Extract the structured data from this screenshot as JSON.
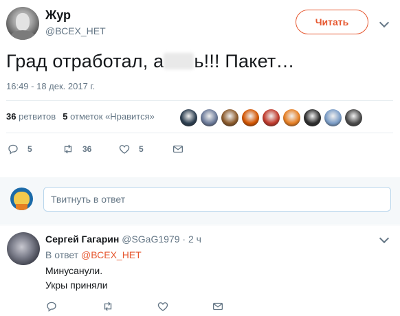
{
  "tweet": {
    "author_name": "Жур",
    "author_handle": "@ВСЕХ_НЕТ",
    "follow_label": "Читать",
    "text_before": "Град отработал, а",
    "text_after": "ь!!! Пакет…",
    "timestamp": "16:49 - 18 дек. 2017 г.",
    "retweets_count": "36",
    "retweets_label": "ретвитов",
    "likes_count": "5",
    "likes_label": "отметок «Нравится»",
    "actions": {
      "replies": "5",
      "retweets": "36",
      "likes": "5"
    },
    "likers": [
      "#2c3e50",
      "#6b7a99",
      "#8b5a2b",
      "#d35400",
      "#c0392b",
      "#e67e22",
      "#2d2d2d",
      "#7a9cc6",
      "#4a4a4a"
    ]
  },
  "reply_box": {
    "placeholder": "Твитнуть в ответ"
  },
  "reply": {
    "name": "Сергей Гагарин",
    "handle": "@SGaG1979",
    "time": "· 2 ч",
    "reply_to_prefix": "В ответ",
    "reply_to_handle": "@ВСЕХ_НЕТ",
    "line1": "Минусанули.",
    "line2": "Укры приняли"
  },
  "colors": {
    "accent": "#e6572f",
    "muted": "#657786",
    "text": "#14171a"
  }
}
